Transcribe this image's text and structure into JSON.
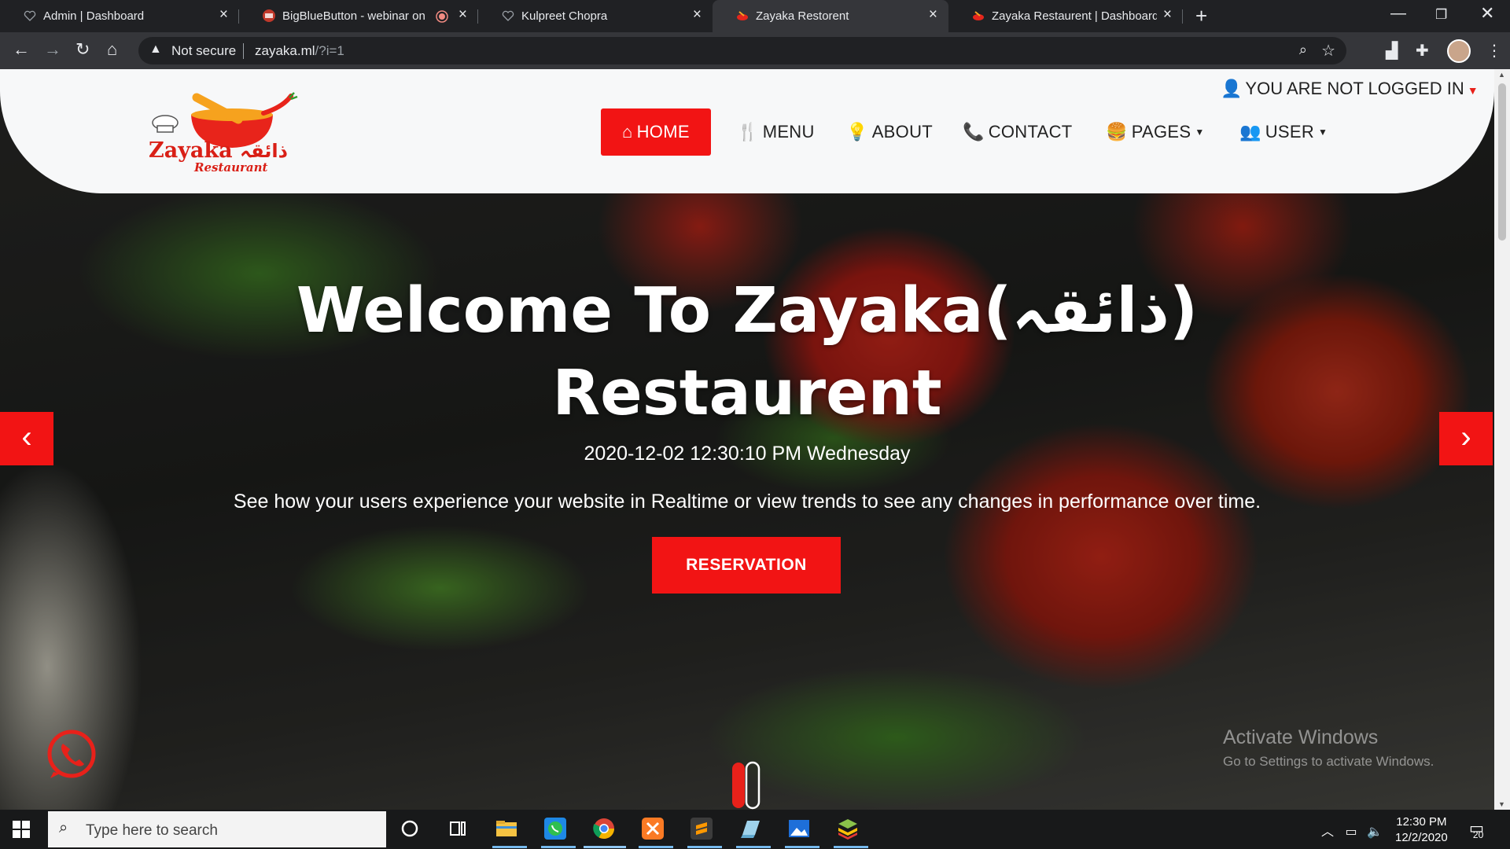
{
  "browser": {
    "tabs": [
      {
        "title": "Admin | Dashboard",
        "active": false
      },
      {
        "title": "BigBlueButton - webinar on p",
        "active": false,
        "recording": true
      },
      {
        "title": "Kulpreet Chopra",
        "active": false
      },
      {
        "title": "Zayaka Restorent",
        "active": true
      },
      {
        "title": "Zayaka Restaurent | Dashboard",
        "active": false
      }
    ],
    "security_label": "Not secure",
    "url_host": "zayaka.ml",
    "url_path": "/?i=1"
  },
  "site": {
    "logo_text_urdu": "ذائقہ",
    "logo_text_latin": "Zayaka",
    "logo_subtext": "Restaurant",
    "login_status": "YOU ARE NOT LOGGED IN",
    "nav": [
      {
        "label": "HOME",
        "icon": "home-icon",
        "active": true
      },
      {
        "label": "MENU",
        "icon": "utensils-icon",
        "active": false
      },
      {
        "label": "ABOUT",
        "icon": "lightbulb-icon",
        "active": false
      },
      {
        "label": "CONTACT",
        "icon": "phone-icon",
        "active": false
      },
      {
        "label": "PAGES",
        "icon": "hamburger-icon",
        "active": false,
        "dropdown": true
      },
      {
        "label": "USER",
        "icon": "users-icon",
        "active": false,
        "dropdown": true
      }
    ],
    "accent_color": "#f21414"
  },
  "hero": {
    "title_line1": "Welcome To Zayaka(ذائقہ)",
    "title_line2": "Restaurent",
    "datetime": "2020-12-02 12:30:10 PM Wednesday",
    "description": "See how your users experience your website in Realtime or view trends to see any changes in performance over time.",
    "button_label": "RESERVATION",
    "prev_arrow": "‹",
    "next_arrow": "›"
  },
  "watermark": {
    "line1": "Activate Windows",
    "line2": "Go to Settings to activate Windows."
  },
  "taskbar": {
    "search_placeholder": "Type here to search",
    "time": "12:30 PM",
    "date": "12/2/2020",
    "notification_count": "20"
  }
}
